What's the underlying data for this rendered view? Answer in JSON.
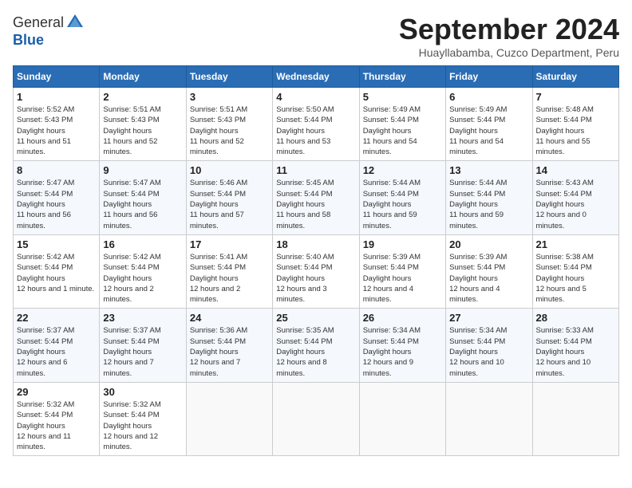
{
  "header": {
    "logo_general": "General",
    "logo_blue": "Blue",
    "month_title": "September 2024",
    "location": "Huayllabamba, Cuzco Department, Peru"
  },
  "weekdays": [
    "Sunday",
    "Monday",
    "Tuesday",
    "Wednesday",
    "Thursday",
    "Friday",
    "Saturday"
  ],
  "weeks": [
    [
      {
        "day": "1",
        "sunrise": "5:52 AM",
        "sunset": "5:43 PM",
        "daylight": "11 hours and 51 minutes."
      },
      {
        "day": "2",
        "sunrise": "5:51 AM",
        "sunset": "5:43 PM",
        "daylight": "11 hours and 52 minutes."
      },
      {
        "day": "3",
        "sunrise": "5:51 AM",
        "sunset": "5:43 PM",
        "daylight": "11 hours and 52 minutes."
      },
      {
        "day": "4",
        "sunrise": "5:50 AM",
        "sunset": "5:44 PM",
        "daylight": "11 hours and 53 minutes."
      },
      {
        "day": "5",
        "sunrise": "5:49 AM",
        "sunset": "5:44 PM",
        "daylight": "11 hours and 54 minutes."
      },
      {
        "day": "6",
        "sunrise": "5:49 AM",
        "sunset": "5:44 PM",
        "daylight": "11 hours and 54 minutes."
      },
      {
        "day": "7",
        "sunrise": "5:48 AM",
        "sunset": "5:44 PM",
        "daylight": "11 hours and 55 minutes."
      }
    ],
    [
      {
        "day": "8",
        "sunrise": "5:47 AM",
        "sunset": "5:44 PM",
        "daylight": "11 hours and 56 minutes."
      },
      {
        "day": "9",
        "sunrise": "5:47 AM",
        "sunset": "5:44 PM",
        "daylight": "11 hours and 56 minutes."
      },
      {
        "day": "10",
        "sunrise": "5:46 AM",
        "sunset": "5:44 PM",
        "daylight": "11 hours and 57 minutes."
      },
      {
        "day": "11",
        "sunrise": "5:45 AM",
        "sunset": "5:44 PM",
        "daylight": "11 hours and 58 minutes."
      },
      {
        "day": "12",
        "sunrise": "5:44 AM",
        "sunset": "5:44 PM",
        "daylight": "11 hours and 59 minutes."
      },
      {
        "day": "13",
        "sunrise": "5:44 AM",
        "sunset": "5:44 PM",
        "daylight": "11 hours and 59 minutes."
      },
      {
        "day": "14",
        "sunrise": "5:43 AM",
        "sunset": "5:44 PM",
        "daylight": "12 hours and 0 minutes."
      }
    ],
    [
      {
        "day": "15",
        "sunrise": "5:42 AM",
        "sunset": "5:44 PM",
        "daylight": "12 hours and 1 minute."
      },
      {
        "day": "16",
        "sunrise": "5:42 AM",
        "sunset": "5:44 PM",
        "daylight": "12 hours and 2 minutes."
      },
      {
        "day": "17",
        "sunrise": "5:41 AM",
        "sunset": "5:44 PM",
        "daylight": "12 hours and 2 minutes."
      },
      {
        "day": "18",
        "sunrise": "5:40 AM",
        "sunset": "5:44 PM",
        "daylight": "12 hours and 3 minutes."
      },
      {
        "day": "19",
        "sunrise": "5:39 AM",
        "sunset": "5:44 PM",
        "daylight": "12 hours and 4 minutes."
      },
      {
        "day": "20",
        "sunrise": "5:39 AM",
        "sunset": "5:44 PM",
        "daylight": "12 hours and 4 minutes."
      },
      {
        "day": "21",
        "sunrise": "5:38 AM",
        "sunset": "5:44 PM",
        "daylight": "12 hours and 5 minutes."
      }
    ],
    [
      {
        "day": "22",
        "sunrise": "5:37 AM",
        "sunset": "5:44 PM",
        "daylight": "12 hours and 6 minutes."
      },
      {
        "day": "23",
        "sunrise": "5:37 AM",
        "sunset": "5:44 PM",
        "daylight": "12 hours and 7 minutes."
      },
      {
        "day": "24",
        "sunrise": "5:36 AM",
        "sunset": "5:44 PM",
        "daylight": "12 hours and 7 minutes."
      },
      {
        "day": "25",
        "sunrise": "5:35 AM",
        "sunset": "5:44 PM",
        "daylight": "12 hours and 8 minutes."
      },
      {
        "day": "26",
        "sunrise": "5:34 AM",
        "sunset": "5:44 PM",
        "daylight": "12 hours and 9 minutes."
      },
      {
        "day": "27",
        "sunrise": "5:34 AM",
        "sunset": "5:44 PM",
        "daylight": "12 hours and 10 minutes."
      },
      {
        "day": "28",
        "sunrise": "5:33 AM",
        "sunset": "5:44 PM",
        "daylight": "12 hours and 10 minutes."
      }
    ],
    [
      {
        "day": "29",
        "sunrise": "5:32 AM",
        "sunset": "5:44 PM",
        "daylight": "12 hours and 11 minutes."
      },
      {
        "day": "30",
        "sunrise": "5:32 AM",
        "sunset": "5:44 PM",
        "daylight": "12 hours and 12 minutes."
      },
      null,
      null,
      null,
      null,
      null
    ]
  ],
  "labels": {
    "sunrise": "Sunrise:",
    "sunset": "Sunset:",
    "daylight": "Daylight hours"
  }
}
